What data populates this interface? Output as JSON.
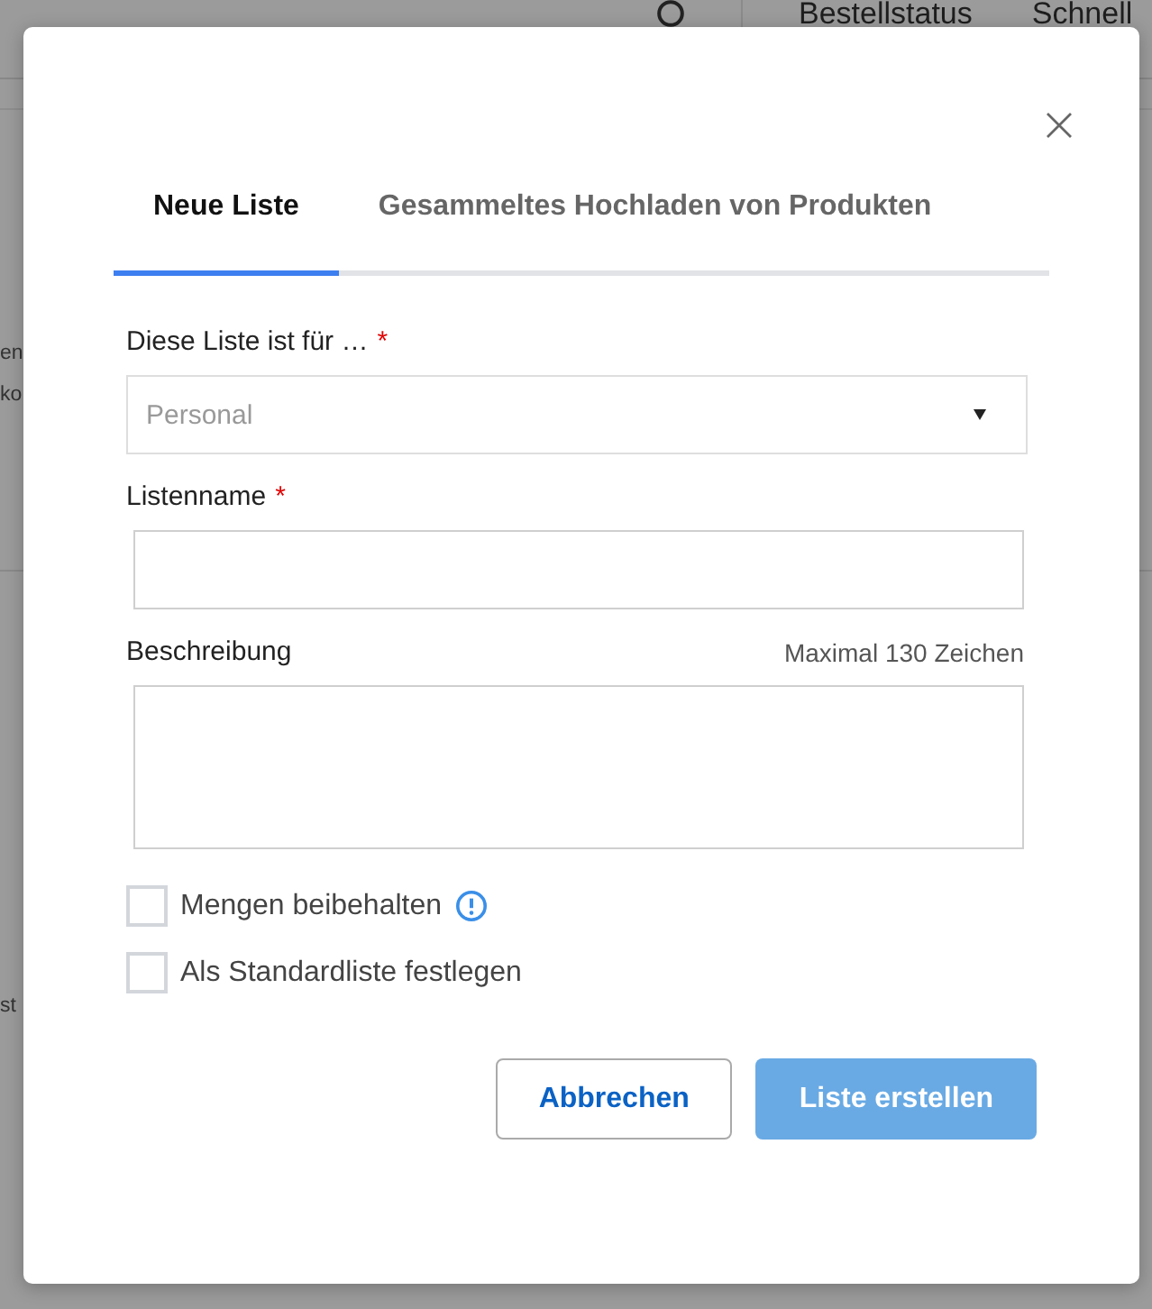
{
  "background_page": {
    "header": {
      "nav_items": [
        "Bestellstatus",
        "Schnell"
      ]
    },
    "side_fragments": [
      "en",
      "ko",
      "st"
    ]
  },
  "dialog": {
    "tabs": [
      {
        "label": "Neue Liste",
        "selected": true
      },
      {
        "label": "Gesammeltes Hochladen von Produkten",
        "selected": false
      }
    ],
    "fields": [
      {
        "kind": "select",
        "label": "Diese Liste ist für …",
        "required_mark": "*",
        "value": "Personal",
        "disabled": true
      },
      {
        "kind": "text",
        "label": "Listenname",
        "required_mark": "*"
      },
      {
        "kind": "textarea",
        "label": "Beschreibung",
        "hint": "Maximal 130 Zeichen"
      }
    ],
    "checkboxes": [
      {
        "label": "Mengen beibehalten",
        "checked": false,
        "info_icon": true
      },
      {
        "label": "Als Standardliste festlegen",
        "checked": false,
        "info_icon": false
      }
    ],
    "buttons": [
      {
        "kind": "secondary",
        "label": "Abbrechen",
        "disabled": false
      },
      {
        "kind": "primary",
        "label": "Liste erstellen",
        "disabled": true
      }
    ]
  }
}
